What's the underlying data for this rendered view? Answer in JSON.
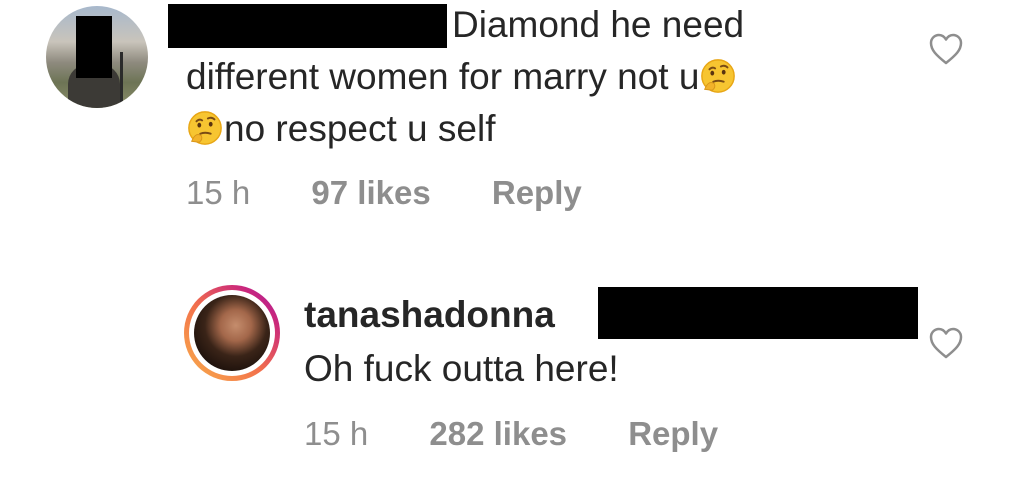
{
  "comments": [
    {
      "avatar": "user-avatar-redacted",
      "text_line1": "Diamond he need",
      "text_line2": "different women for marry not u",
      "text_line3": "no respect u self",
      "emoji": "thinking-face",
      "time": "15 h",
      "likes": "97 likes",
      "reply": "Reply",
      "like_icon": "heart-outline-icon"
    },
    {
      "avatar": "tanashadonna-avatar",
      "username": "tanashadonna",
      "text": "Oh fuck outta here!",
      "time": "15 h",
      "likes": "282 likes",
      "reply": "Reply",
      "like_icon": "heart-outline-icon"
    }
  ],
  "colors": {
    "text": "#262626",
    "meta": "#8e8e8e",
    "heart": "#8e8e8e",
    "story_ring_start": "#f9b14b",
    "story_ring_end": "#a21fa8"
  }
}
